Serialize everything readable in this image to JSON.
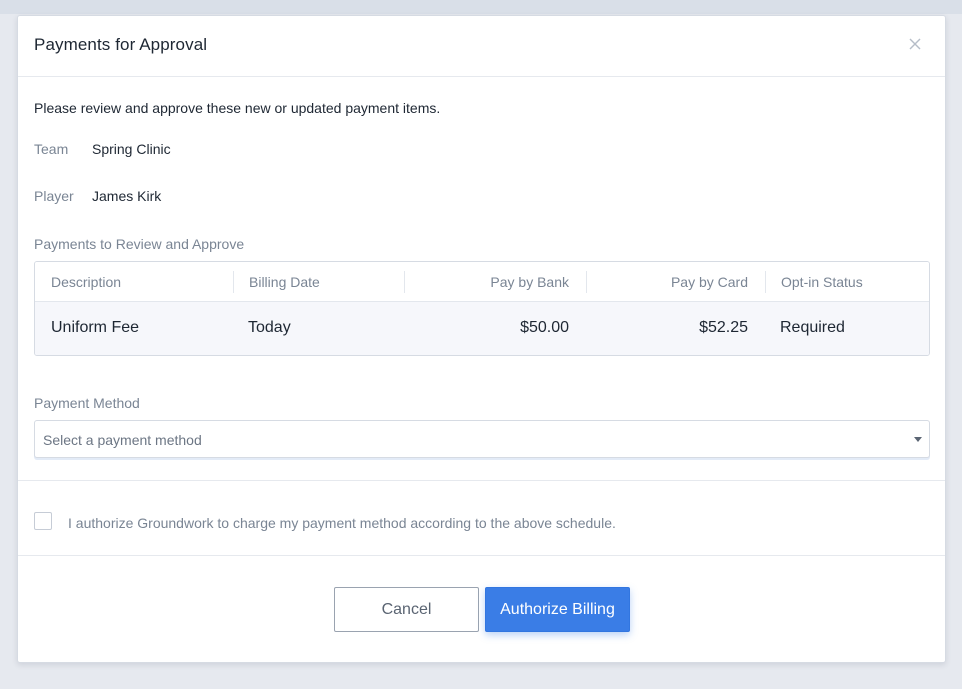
{
  "modal": {
    "title": "Payments for Approval",
    "intro": "Please review and approve these new or updated payment items."
  },
  "details": {
    "team_label": "Team",
    "team_value": "Spring Clinic",
    "player_label": "Player",
    "player_value": "James Kirk"
  },
  "payments": {
    "section_label": "Payments to Review and Approve",
    "columns": [
      "Description",
      "Billing Date",
      "Pay by Bank",
      "Pay by Card",
      "Opt-in Status"
    ],
    "rows": [
      {
        "description": "Uniform Fee",
        "billing_date": "Today",
        "pay_by_bank": "$50.00",
        "pay_by_card": "$52.25",
        "opt_in_status": "Required"
      }
    ]
  },
  "payment_method": {
    "label": "Payment Method",
    "placeholder": "Select a payment method"
  },
  "authorization": {
    "checked": false,
    "text": "I authorize Groundwork to charge my payment method according to the above schedule."
  },
  "actions": {
    "cancel_label": "Cancel",
    "authorize_label": "Authorize Billing"
  },
  "icons": {
    "close": "close-icon",
    "dropdown": "caret-down-icon",
    "checkbox": "checkbox-icon"
  },
  "colors": {
    "primary": "#3a7de6",
    "text": "#1e2733",
    "muted": "#7a8594",
    "row_bg": "#f6f7fb"
  }
}
